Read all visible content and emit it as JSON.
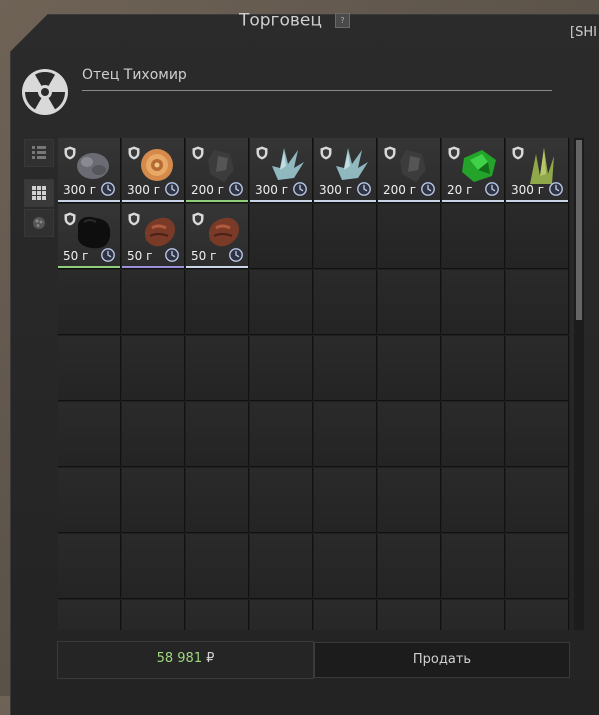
{
  "window": {
    "title": "Торговец",
    "help": "?",
    "tag": "[SHI"
  },
  "trader": {
    "name": "Отец Тихомир",
    "icon": "radiation-icon"
  },
  "sidebar": [
    {
      "icon": "list-view-icon"
    },
    {
      "icon": "grid-view-icon",
      "active": true
    },
    {
      "icon": "artifact-filter-icon"
    }
  ],
  "grid": {
    "columns": 8,
    "rows": 8
  },
  "items": [
    {
      "price": "300 г",
      "kind": "grey-rock",
      "color": "#6b6b74",
      "border": "#c9d4e6"
    },
    {
      "price": "300 г",
      "kind": "orange-swirl",
      "color": "#d58a4b",
      "border": "#c9d4e6"
    },
    {
      "price": "200 г",
      "kind": "dark-shard",
      "color": "#3c3c3c",
      "border": "#8fcf7a"
    },
    {
      "price": "300 г",
      "kind": "crystal",
      "color": "#8fb8bf",
      "border": "#c9d4e6"
    },
    {
      "price": "300 г",
      "kind": "crystal",
      "color": "#8fb8bf",
      "border": "#c9d4e6"
    },
    {
      "price": "200 г",
      "kind": "dark-shard",
      "color": "#3c3c3c",
      "border": "#c9d4e6"
    },
    {
      "price": "20 г",
      "kind": "green-crystal",
      "color": "#23a32a",
      "border": "#c9d4e6"
    },
    {
      "price": "300 г",
      "kind": "green-spikes",
      "color": "#8ea84a",
      "border": "#c9d4e6"
    },
    {
      "price": "50 г",
      "kind": "black-blob",
      "color": "#0e0e0e",
      "border": "#8fcf7a"
    },
    {
      "price": "50 г",
      "kind": "red-flesh",
      "color": "#7a3a28",
      "border": "#9a8fd8"
    },
    {
      "price": "50 г",
      "kind": "red-flesh",
      "color": "#7a3a28",
      "border": "#c9d4e6"
    }
  ],
  "footer": {
    "money": "58 981",
    "currency": "₽",
    "sell_label": "Продать"
  }
}
